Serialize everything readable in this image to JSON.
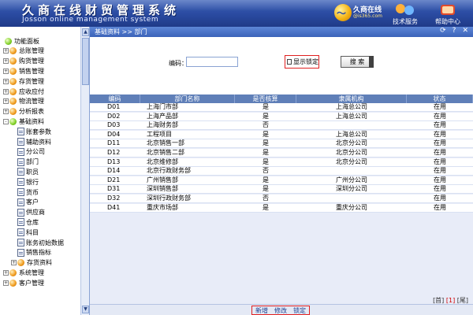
{
  "header": {
    "title_cn": "久商在线财贸管理系统",
    "title_en": "Josson online management system",
    "brand_name": "久商在线",
    "brand_domain": "@is365.com",
    "buttons": [
      {
        "label": "技术服务",
        "icon": "support-icon"
      },
      {
        "label": "帮助中心",
        "icon": "help-icon"
      }
    ]
  },
  "sidebar": {
    "items": [
      {
        "label": "功能面板",
        "level": 0,
        "icon": "green-ball",
        "toggle": ""
      },
      {
        "label": "总账管理",
        "level": 1,
        "icon": "orange-ball",
        "toggle": "+"
      },
      {
        "label": "购货管理",
        "level": 1,
        "icon": "orange-ball",
        "toggle": "+"
      },
      {
        "label": "销售管理",
        "level": 1,
        "icon": "orange-ball",
        "toggle": "+"
      },
      {
        "label": "存货管理",
        "level": 1,
        "icon": "orange-ball",
        "toggle": "+"
      },
      {
        "label": "应收应付",
        "level": 1,
        "icon": "orange-ball",
        "toggle": "+"
      },
      {
        "label": "物流管理",
        "level": 1,
        "icon": "orange-ball",
        "toggle": "+"
      },
      {
        "label": "分析报表",
        "level": 1,
        "icon": "orange-ball",
        "toggle": "+"
      },
      {
        "label": "基础资料",
        "level": 1,
        "icon": "green-ball",
        "toggle": "-"
      },
      {
        "label": "账套参数",
        "level": 2,
        "icon": "doc"
      },
      {
        "label": "辅助资料",
        "level": 2,
        "icon": "doc"
      },
      {
        "label": "分公司",
        "level": 2,
        "icon": "doc"
      },
      {
        "label": "部门",
        "level": 2,
        "icon": "doc"
      },
      {
        "label": "职员",
        "level": 2,
        "icon": "doc"
      },
      {
        "label": "银行",
        "level": 2,
        "icon": "doc"
      },
      {
        "label": "货币",
        "level": 2,
        "icon": "doc"
      },
      {
        "label": "客户",
        "level": 2,
        "icon": "doc"
      },
      {
        "label": "供应商",
        "level": 2,
        "icon": "doc"
      },
      {
        "label": "仓库",
        "level": 2,
        "icon": "doc"
      },
      {
        "label": "科目",
        "level": 2,
        "icon": "doc"
      },
      {
        "label": "账务初始数据",
        "level": 2,
        "icon": "doc"
      },
      {
        "label": "销售指标",
        "level": 2,
        "icon": "doc"
      },
      {
        "label": "存货资料",
        "level": 2,
        "icon": "orange-ball",
        "toggle": "+"
      },
      {
        "label": "系统管理",
        "level": 1,
        "icon": "orange-ball",
        "toggle": "+"
      },
      {
        "label": "客户管理",
        "level": 1,
        "icon": "orange-ball",
        "toggle": "+"
      }
    ]
  },
  "breadcrumb": "基础资料 >> 部门",
  "toolbar_icons": [
    "refresh-icon",
    "help-icon",
    "close-icon"
  ],
  "toolbar_glyphs": [
    "⟳",
    "?",
    "✕"
  ],
  "search": {
    "code_label": "编码：",
    "code_value": "",
    "show_locked_label": "显示锁定",
    "search_button": "搜 索"
  },
  "table": {
    "columns": [
      "编码",
      "部门名称",
      "是否核算",
      "隶属机构",
      "状态"
    ],
    "rows": [
      [
        "D01",
        "上海门市部",
        "是",
        "上海总公司",
        "在用"
      ],
      [
        "D02",
        "上海产品部",
        "是",
        "上海总公司",
        "在用"
      ],
      [
        "D03",
        "上海财务部",
        "否",
        "",
        "在用"
      ],
      [
        "D04",
        "工程项目",
        "是",
        "上海总公司",
        "在用"
      ],
      [
        "D11",
        "北京销售一部",
        "是",
        "北京分公司",
        "在用"
      ],
      [
        "D12",
        "北京销售二部",
        "是",
        "北京分公司",
        "在用"
      ],
      [
        "D13",
        "北京维修部",
        "是",
        "北京分公司",
        "在用"
      ],
      [
        "D14",
        "北京行政财务部",
        "否",
        "",
        "在用"
      ],
      [
        "D21",
        "广州销售部",
        "是",
        "广州分公司",
        "在用"
      ],
      [
        "D31",
        "深圳销售部",
        "是",
        "深圳分公司",
        "在用"
      ],
      [
        "D32",
        "深圳行政财务部",
        "否",
        "",
        "在用"
      ],
      [
        "D41",
        "重庆市场部",
        "是",
        "重庆分公司",
        "在用"
      ]
    ]
  },
  "pager": {
    "first": "[首]",
    "current": "[1]",
    "last": "[尾]"
  },
  "actions": {
    "add": "新增",
    "edit": "修改",
    "lock": "锁定"
  },
  "colors": {
    "header": "#2a4aa0",
    "accent_red": "#e02020",
    "table_header": "#5f7fb8"
  }
}
